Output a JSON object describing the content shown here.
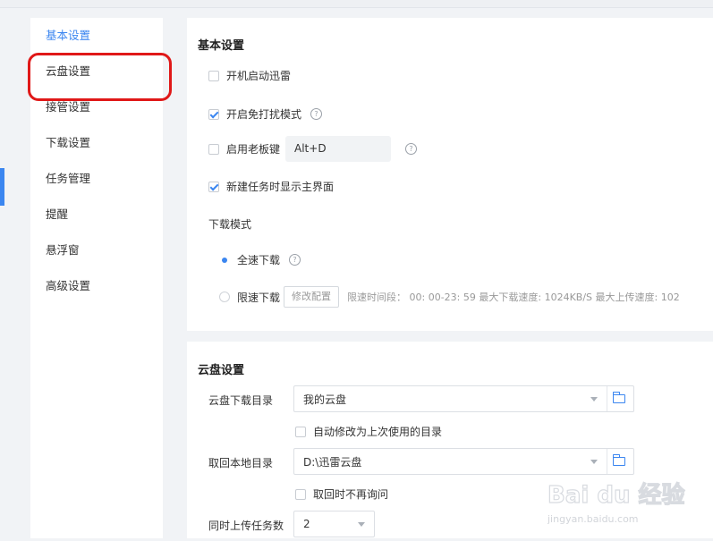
{
  "sidebar": {
    "items": [
      {
        "label": "基本设置",
        "active": true
      },
      {
        "label": "云盘设置",
        "active": false
      },
      {
        "label": "接管设置",
        "active": false
      },
      {
        "label": "下载设置",
        "active": false
      },
      {
        "label": "任务管理",
        "active": false
      },
      {
        "label": "提醒",
        "active": false
      },
      {
        "label": "悬浮窗",
        "active": false
      },
      {
        "label": "高级设置",
        "active": false
      }
    ]
  },
  "basic": {
    "title": "基本设置",
    "startup": {
      "label": "开机启动迅雷",
      "checked": false
    },
    "dnd": {
      "label": "开启免打扰模式",
      "checked": true
    },
    "bosskey": {
      "label": "启用老板键",
      "checked": false,
      "value": "Alt+D"
    },
    "show_main": {
      "label": "新建任务时显示主界面",
      "checked": true
    },
    "download_mode": {
      "label": "下载模式",
      "full_speed": {
        "label": "全速下载",
        "selected": true
      },
      "limited": {
        "label": "限速下载",
        "selected": false,
        "modify_button": "修改配置",
        "info": "限速时间段： 00: 00-23: 59   最大下载速度: 1024KB/S   最大上传速度: 102"
      }
    }
  },
  "cloud": {
    "title": "云盘设置",
    "download_dir": {
      "label": "云盘下载目录",
      "value": "我的云盘"
    },
    "auto_change": {
      "label": "自动修改为上次使用的目录",
      "checked": false
    },
    "local_dir": {
      "label": "取回本地目录",
      "value": "D:\\迅雷云盘"
    },
    "no_ask": {
      "label": "取回时不再询问",
      "checked": false
    },
    "upload_tasks": {
      "label": "同时上传任务数",
      "value": "2"
    }
  },
  "watermark": {
    "brand": "Bai du 经验",
    "url": "jingyan.baidu.com"
  },
  "colors": {
    "accent": "#3b86f0",
    "annotation": "#e01818"
  }
}
